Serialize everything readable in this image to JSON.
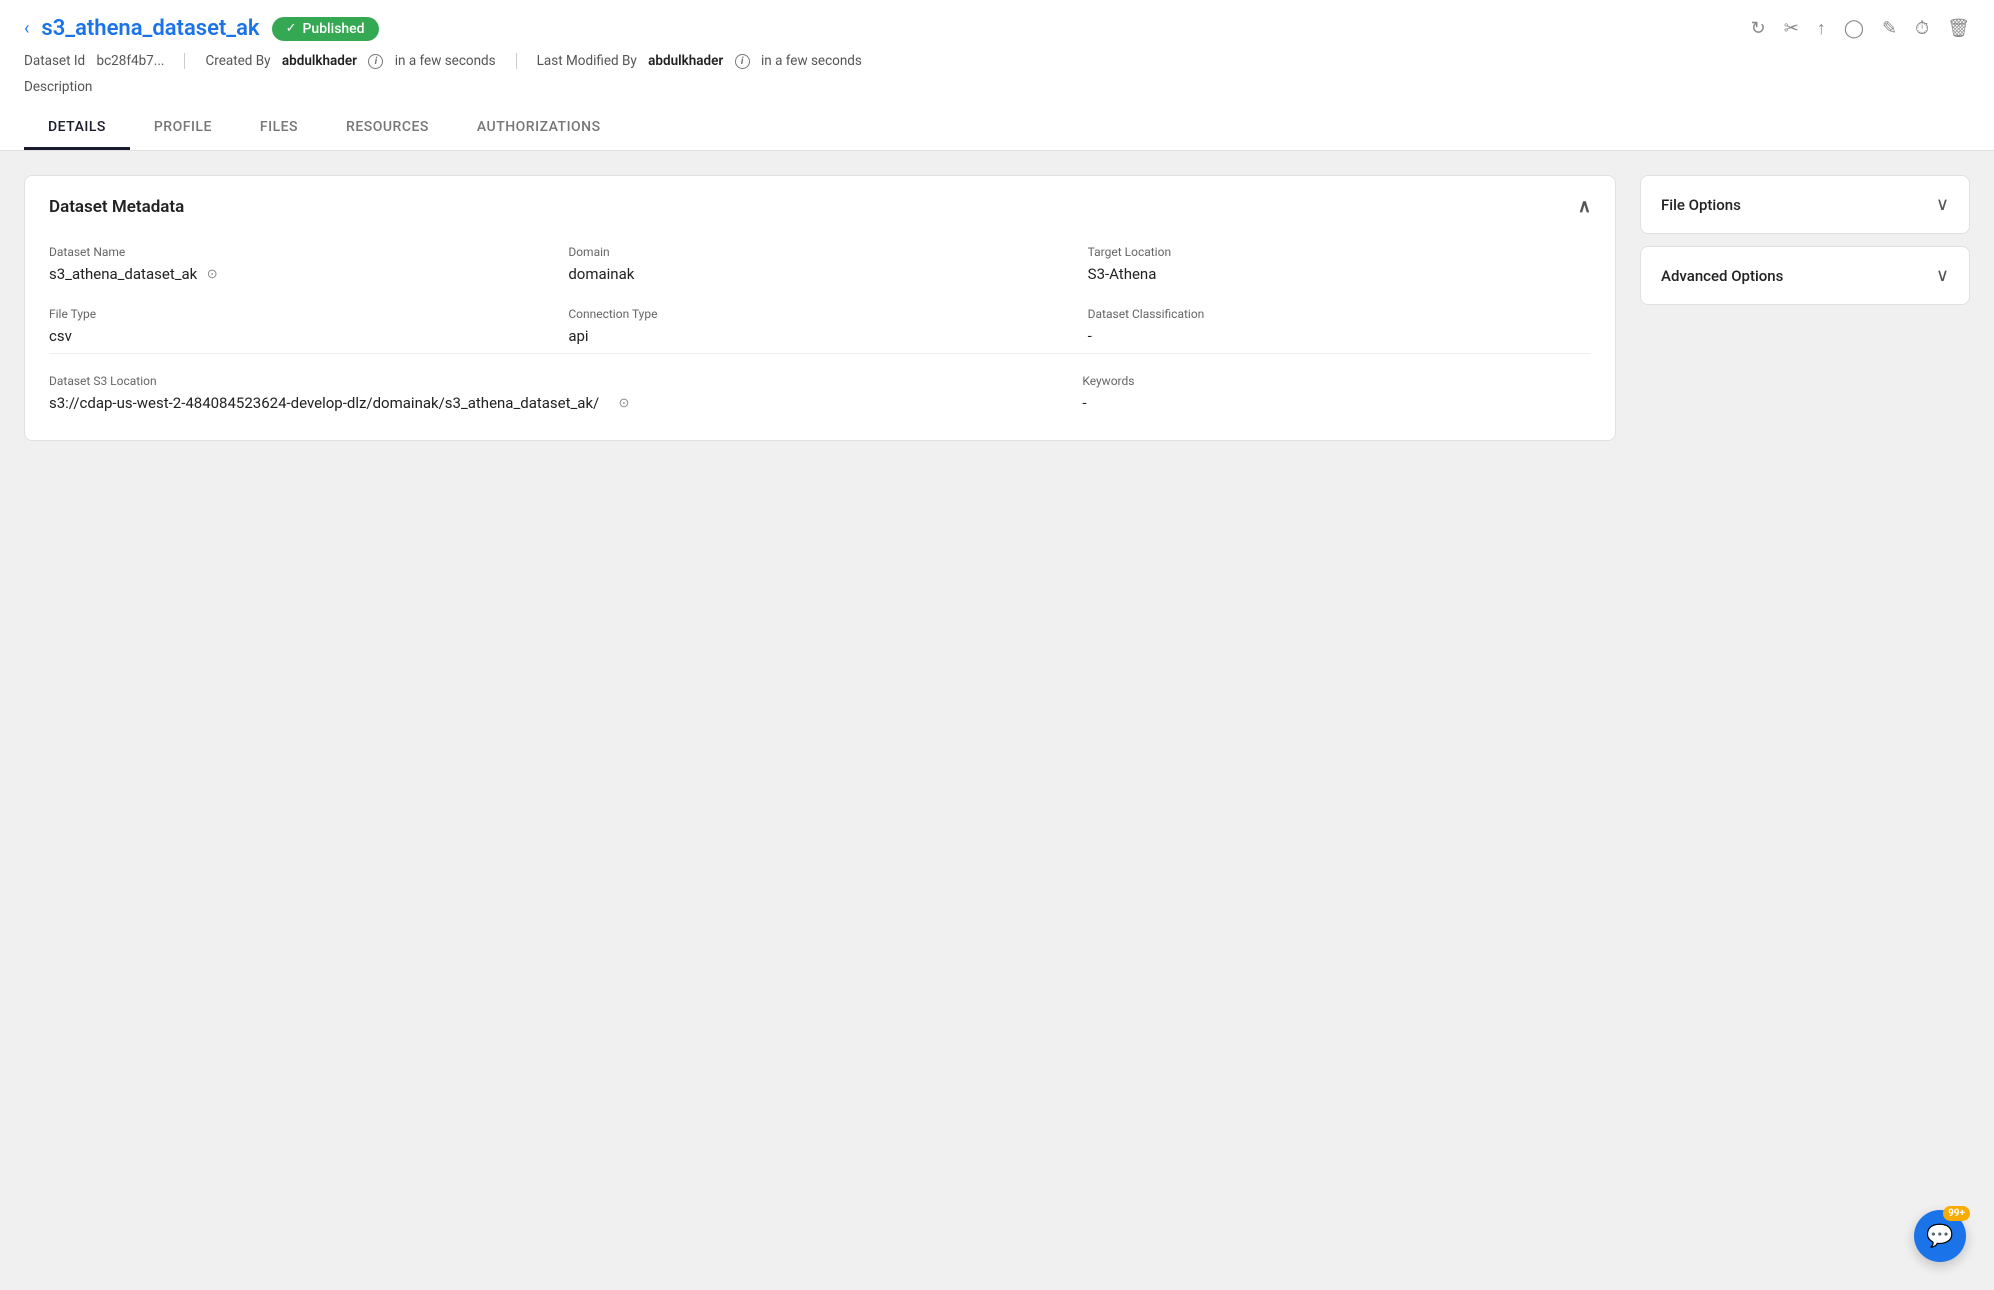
{
  "header": {
    "back_label": "‹",
    "dataset_name": "s3_athena_dataset_ak",
    "status_label": "Published",
    "status_check": "✓"
  },
  "toolbar": {
    "icons": [
      {
        "name": "refresh-icon",
        "symbol": "↻"
      },
      {
        "name": "scissors-icon",
        "symbol": "✂"
      },
      {
        "name": "share-icon",
        "symbol": "⬆"
      },
      {
        "name": "circle-icon",
        "symbol": "◯"
      },
      {
        "name": "edit-icon",
        "symbol": "✎"
      },
      {
        "name": "history-icon",
        "symbol": "⏱"
      },
      {
        "name": "delete-icon",
        "symbol": "🗑"
      }
    ]
  },
  "meta": {
    "dataset_id_label": "Dataset Id",
    "dataset_id_value": "bc28f4b7...",
    "created_by_label": "Created By",
    "created_by_user": "abdulkhader",
    "created_by_time": "in a few seconds",
    "last_modified_label": "Last Modified By",
    "last_modified_user": "abdulkhader",
    "last_modified_time": "in a few seconds",
    "description_label": "Description"
  },
  "tabs": [
    {
      "label": "DETAILS",
      "active": true
    },
    {
      "label": "PROFILE",
      "active": false
    },
    {
      "label": "FILES",
      "active": false
    },
    {
      "label": "RESOURCES",
      "active": false
    },
    {
      "label": "AUTHORIZATIONS",
      "active": false
    }
  ],
  "dataset_metadata": {
    "section_title": "Dataset Metadata",
    "fields": {
      "dataset_name_label": "Dataset Name",
      "dataset_name_value": "s3_athena_dataset_ak",
      "domain_label": "Domain",
      "domain_value": "domainak",
      "target_location_label": "Target Location",
      "target_location_value": "S3-Athena",
      "file_type_label": "File Type",
      "file_type_value": "csv",
      "connection_type_label": "Connection Type",
      "connection_type_value": "api",
      "dataset_classification_label": "Dataset Classification",
      "dataset_classification_value": "-",
      "s3_location_label": "Dataset S3 Location",
      "s3_location_value": "s3://cdap-us-west-2-484084523624-develop-dlz/domainak/s3_athena_dataset_ak/",
      "keywords_label": "Keywords",
      "keywords_value": "-"
    }
  },
  "right_panel": {
    "file_options_label": "File Options",
    "advanced_options_label": "Advanced Options"
  },
  "chat": {
    "badge": "99+",
    "icon": "💬"
  }
}
